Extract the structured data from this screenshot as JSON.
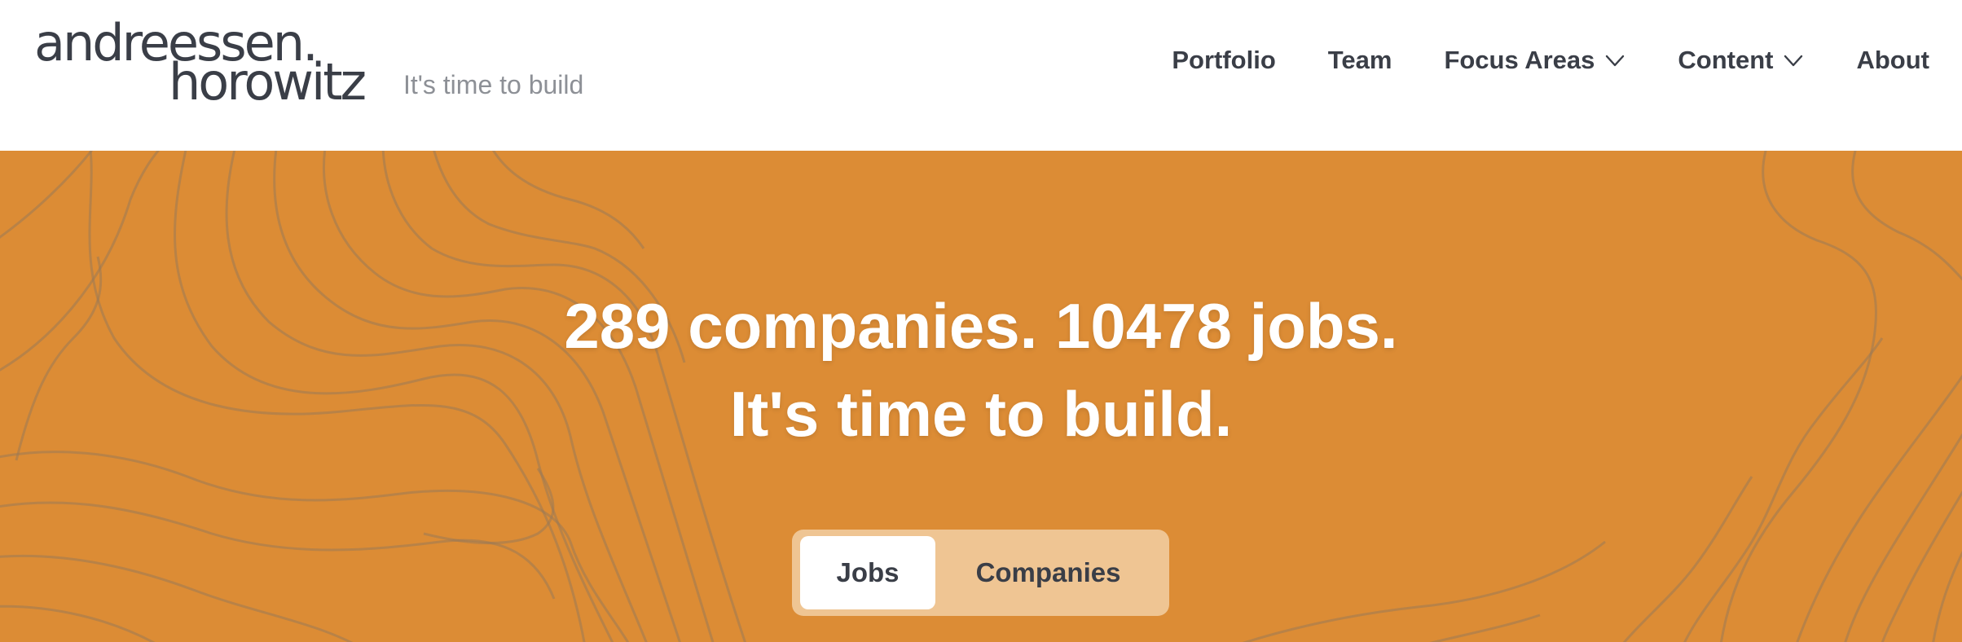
{
  "header": {
    "logo_line1": "andreessen.",
    "logo_line2": "horowitz",
    "tagline": "It's time to build",
    "nav": [
      {
        "label": "Portfolio"
      },
      {
        "label": "Team"
      },
      {
        "label": "Focus Areas",
        "icon": "chevron-down-icon"
      },
      {
        "label": "Content",
        "icon": "chevron-down-icon"
      },
      {
        "label": "About"
      }
    ]
  },
  "hero": {
    "headline_line1": "289 companies. 10478 jobs.",
    "headline_line2": "It's time to build.",
    "background_color": "#dc8c35",
    "toggle": {
      "jobs_label": "Jobs",
      "companies_label": "Companies",
      "selected": "Jobs"
    }
  },
  "colors": {
    "text_dark": "#3a3e47",
    "tagline_gray": "#8d9096",
    "accent_orange": "#dc8c35",
    "toggle_bg": "#efc593"
  }
}
